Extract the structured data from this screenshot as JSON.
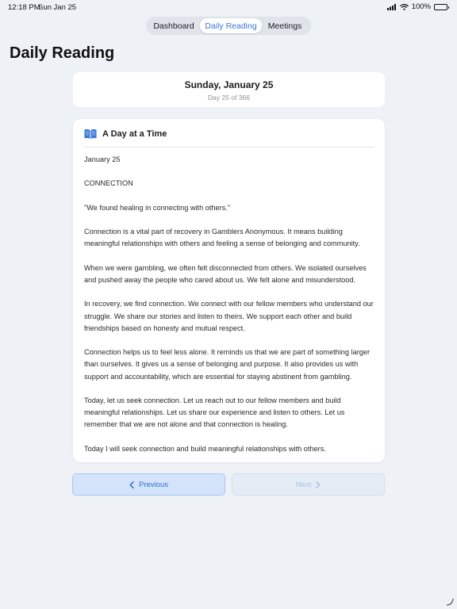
{
  "status": {
    "time": "12:18 PM",
    "date": "Sun Jan 25",
    "battery": "100%"
  },
  "tabs": [
    {
      "label": "Dashboard"
    },
    {
      "label": "Daily Reading",
      "selected": true
    },
    {
      "label": "Meetings"
    }
  ],
  "page_title": "Daily Reading",
  "date_card": {
    "date": "Sunday, January 25",
    "day_of_year": "Day 25 of 366"
  },
  "reading": {
    "source_title": "A Day at a Time",
    "paragraphs": [
      "January 25",
      "CONNECTION",
      "\"We found healing in connecting with others.\"",
      "Connection is a vital part of recovery in Gamblers Anonymous. It means building meaningful relationships with others and feeling a sense of belonging and community.",
      "When we were gambling, we often felt disconnected from others. We isolated ourselves and pushed away the people who cared about us. We felt alone and misunderstood.",
      "In recovery, we find connection. We connect with our fellow members who understand our struggle. We share our stories and listen to theirs. We support each other and build friendships based on honesty and mutual respect.",
      "Connection helps us to feel less alone. It reminds us that we are part of something larger than ourselves. It gives us a sense of belonging and purpose. It also provides us with support and accountability, which are essential for staying abstinent from gambling.",
      "Today, let us seek connection. Let us reach out to our fellow members and build meaningful relationships. Let us share our experience and listen to others. Let us remember that we are not alone and that connection is healing.",
      "Today I will seek connection and build meaningful relationships with others."
    ]
  },
  "navigation": {
    "previous_label": "Previous",
    "next_label": "Next",
    "next_enabled": false
  },
  "colors": {
    "accent": "#3a78d8",
    "background": "#eef1f6",
    "card": "#ffffff"
  }
}
